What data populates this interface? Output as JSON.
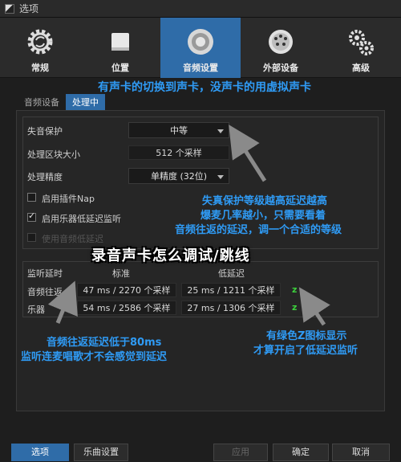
{
  "window": {
    "title": "选项"
  },
  "toolbar": {
    "items": [
      {
        "label": "常规",
        "icon": "gear-icon"
      },
      {
        "label": "位置",
        "icon": "drive-icon"
      },
      {
        "label": "音频设置",
        "icon": "speaker-icon",
        "active": true
      },
      {
        "label": "外部设备",
        "icon": "connector-icon"
      },
      {
        "label": "高级",
        "icon": "gears-icon"
      }
    ]
  },
  "tabs": [
    {
      "label": "音频设备"
    },
    {
      "label": "处理中",
      "active": true
    }
  ],
  "processing": {
    "dropout_protection": {
      "label": "失音保护",
      "value": "中等"
    },
    "block_size": {
      "label": "处理区块大小",
      "value": "512 个采样"
    },
    "precision": {
      "label": "处理精度",
      "value": "单精度 (32位)"
    },
    "enable_plugin_nap": {
      "label": "启用插件Nap",
      "checked": false
    },
    "enable_low_latency": {
      "label": "启用乐器低延迟监听",
      "checked": true
    },
    "use_system_low_latency": {
      "label": "使用音频低延迟",
      "checked": false,
      "disabled": true
    }
  },
  "latency": {
    "header": {
      "label": "监听延时",
      "standard": "标准",
      "low": "低延迟"
    },
    "rows": [
      {
        "label": "音频往返",
        "standard": "47 ms / 2270 个采样",
        "low": "25 ms / 1211 个采样",
        "indicator": "z"
      },
      {
        "label": "乐器",
        "standard": "54 ms / 2586 个采样",
        "low": "27 ms / 1306 个采样",
        "indicator": "z"
      }
    ]
  },
  "buttons": {
    "options": "选项",
    "song_settings": "乐曲设置",
    "apply": "应用",
    "ok": "确定",
    "cancel": "取消"
  },
  "annotations": {
    "top": "有声卡的切换到声卡，没声卡的用虚拟声卡",
    "middle_1": "失真保护等级越高延迟越高",
    "middle_2": "爆麦几率越小，只需要看着",
    "middle_3": "音频往返的延迟，调一个合适的等级",
    "title": "录音声卡怎么调试/跳线",
    "bottom_left_1": "音频往返延迟低于80ms",
    "bottom_left_2": "监听连麦唱歌才不会感觉到延迟",
    "bottom_right_1": "有绿色Z图标显示",
    "bottom_right_2": "才算开启了低延迟监听"
  },
  "colors": {
    "accent": "#2f6ca8",
    "annotation": "#2f9bf5",
    "indicator": "#3cd03c"
  }
}
